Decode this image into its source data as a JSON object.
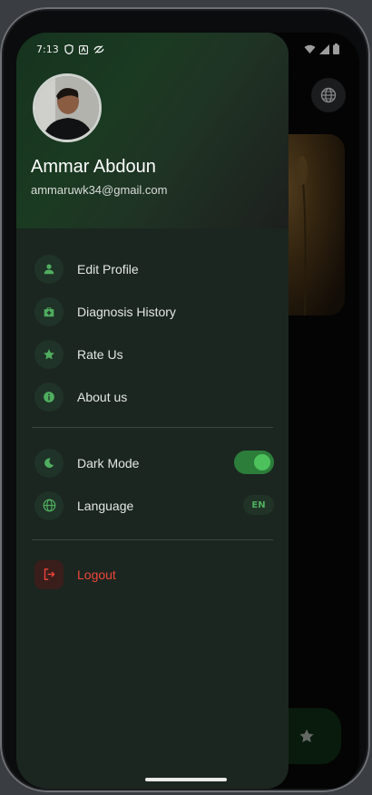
{
  "status_bar": {
    "time": "7:13"
  },
  "user": {
    "name": "Ammar Abdoun",
    "email": "ammaruwk34@gmail.com"
  },
  "menu": {
    "items": [
      {
        "label": "Edit Profile",
        "icon": "person-icon"
      },
      {
        "label": "Diagnosis History",
        "icon": "medical-kit-icon"
      },
      {
        "label": "Rate Us",
        "icon": "star-icon"
      },
      {
        "label": "About us",
        "icon": "info-icon"
      }
    ],
    "settings": [
      {
        "label": "Dark Mode",
        "icon": "moon-icon",
        "toggle_on": true
      },
      {
        "label": "Language",
        "icon": "globe-icon",
        "value": "EN"
      }
    ],
    "logout_label": "Logout"
  },
  "colors": {
    "accent": "#4fae5f",
    "logout": "#f0453a",
    "drawer_bg": "#1b2620"
  }
}
